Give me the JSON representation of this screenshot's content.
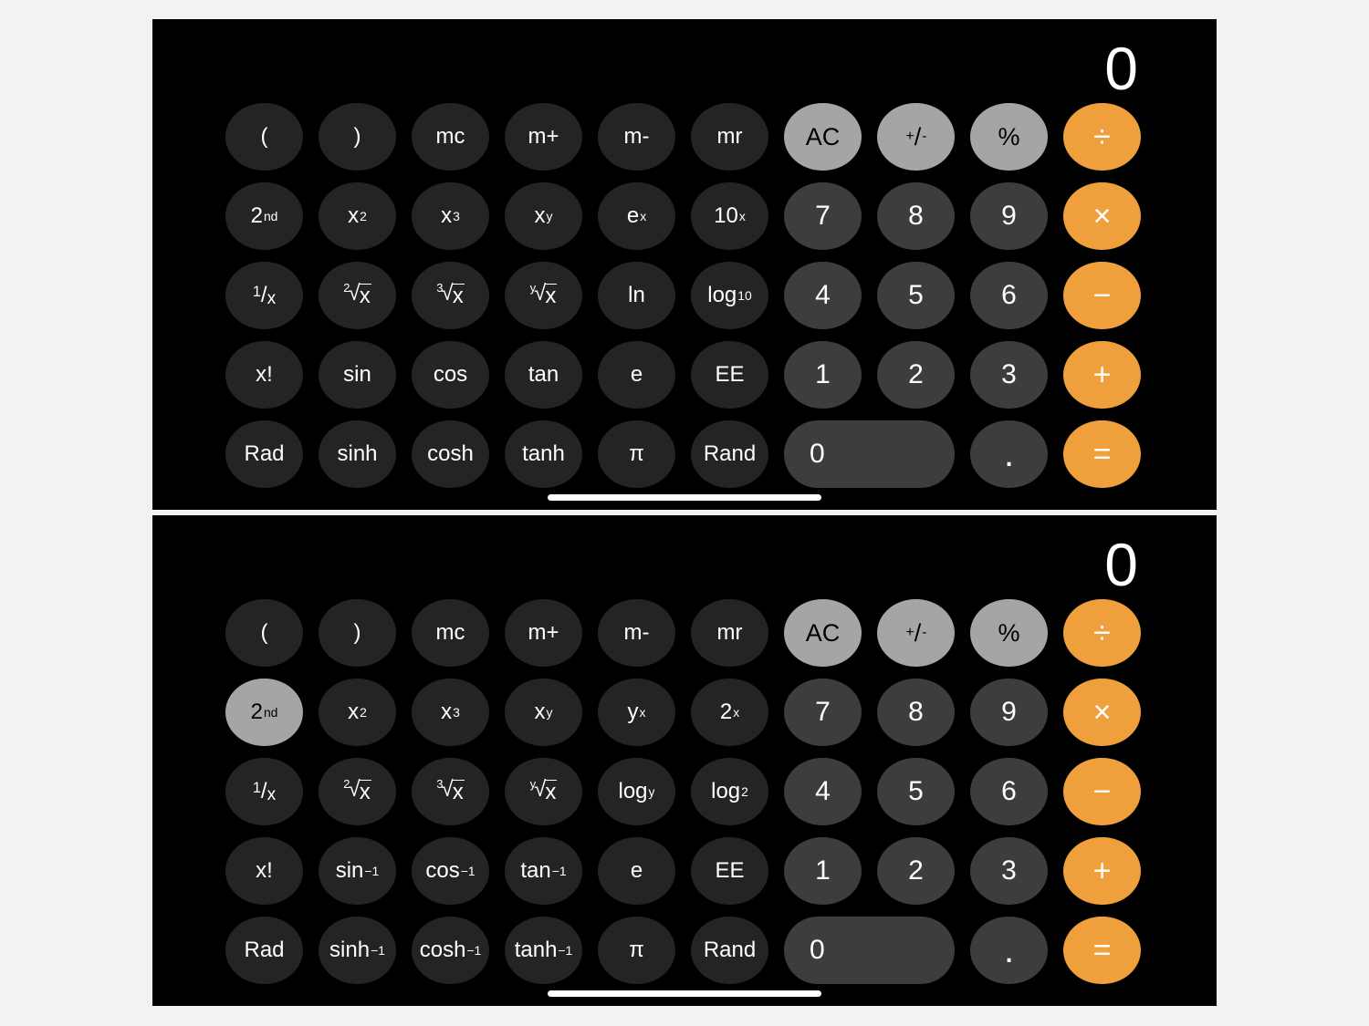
{
  "page": {
    "background_color": "#f2f2f2"
  },
  "colors": {
    "screen_background": "#000000",
    "function_key": "#242424",
    "number_key": "#3d3d3d",
    "utility_key": "#a5a5a5",
    "operator_key": "#ef9f3c",
    "active_key": "#a5a5a5",
    "text_light": "#ffffff",
    "text_dark": "#000000"
  },
  "calculators": [
    {
      "id": "scientific-primary",
      "display_value": "0",
      "second_function_active": false,
      "rows": [
        [
          {
            "label": "(",
            "name": "open-paren",
            "type": "fn"
          },
          {
            "label": ")",
            "name": "close-paren",
            "type": "fn"
          },
          {
            "label": "mc",
            "name": "memory-clear",
            "type": "fn"
          },
          {
            "label": "m+",
            "name": "memory-add",
            "type": "fn"
          },
          {
            "label": "m-",
            "name": "memory-subtract",
            "type": "fn"
          },
          {
            "label": "mr",
            "name": "memory-recall",
            "type": "fn"
          },
          {
            "label": "AC",
            "name": "all-clear",
            "type": "util"
          },
          {
            "label": "+/-",
            "name": "sign-toggle",
            "type": "util",
            "html": "<sup>+</sup>/<sub>-</sub>"
          },
          {
            "label": "%",
            "name": "percent",
            "type": "util"
          },
          {
            "label": "÷",
            "name": "divide",
            "type": "op"
          }
        ],
        [
          {
            "label": "2nd",
            "name": "second-function",
            "type": "fn",
            "html": "2<sup>nd</sup>"
          },
          {
            "label": "x²",
            "name": "x-squared",
            "type": "fn",
            "html": "x<sup>2</sup>"
          },
          {
            "label": "x³",
            "name": "x-cubed",
            "type": "fn",
            "html": "x<sup>3</sup>"
          },
          {
            "label": "xʸ",
            "name": "x-to-the-y",
            "type": "fn",
            "html": "x<sup>y</sup>"
          },
          {
            "label": "eˣ",
            "name": "e-to-the-x",
            "type": "fn",
            "html": "e<sup>x</sup>"
          },
          {
            "label": "10ˣ",
            "name": "ten-to-the-x",
            "type": "fn",
            "html": "10<sup>x</sup>"
          },
          {
            "label": "7",
            "name": "digit-7",
            "type": "num"
          },
          {
            "label": "8",
            "name": "digit-8",
            "type": "num"
          },
          {
            "label": "9",
            "name": "digit-9",
            "type": "num"
          },
          {
            "label": "×",
            "name": "multiply",
            "type": "op"
          }
        ],
        [
          {
            "label": "1/x",
            "name": "reciprocal",
            "type": "fn",
            "html": "<span class='frac'><span class='n'>1</span><span class='sl'>/</span><span class='d'>x</span></span>"
          },
          {
            "label": "²√x",
            "name": "square-root",
            "type": "fn",
            "html": "<span class='rad'><span class='idx'>2</span><span class='sq'>&#8730;</span><span class='rx'>x</span></span>"
          },
          {
            "label": "³√x",
            "name": "cube-root",
            "type": "fn",
            "html": "<span class='rad'><span class='idx'>3</span><span class='sq'>&#8730;</span><span class='rx'>x</span></span>"
          },
          {
            "label": "ʸ√x",
            "name": "y-root",
            "type": "fn",
            "html": "<span class='rad'><span class='idx'>y</span><span class='sq'>&#8730;</span><span class='rx'>x</span></span>"
          },
          {
            "label": "ln",
            "name": "natural-log",
            "type": "fn"
          },
          {
            "label": "log10",
            "name": "log-base-10",
            "type": "fn",
            "html": "log<sub>10</sub>"
          },
          {
            "label": "4",
            "name": "digit-4",
            "type": "num"
          },
          {
            "label": "5",
            "name": "digit-5",
            "type": "num"
          },
          {
            "label": "6",
            "name": "digit-6",
            "type": "num"
          },
          {
            "label": "−",
            "name": "subtract",
            "type": "op"
          }
        ],
        [
          {
            "label": "x!",
            "name": "factorial",
            "type": "fn"
          },
          {
            "label": "sin",
            "name": "sine",
            "type": "fn"
          },
          {
            "label": "cos",
            "name": "cosine",
            "type": "fn"
          },
          {
            "label": "tan",
            "name": "tangent",
            "type": "fn"
          },
          {
            "label": "e",
            "name": "euler-constant",
            "type": "fn"
          },
          {
            "label": "EE",
            "name": "exponent-entry",
            "type": "fn"
          },
          {
            "label": "1",
            "name": "digit-1",
            "type": "num"
          },
          {
            "label": "2",
            "name": "digit-2",
            "type": "num"
          },
          {
            "label": "3",
            "name": "digit-3",
            "type": "num"
          },
          {
            "label": "+",
            "name": "add",
            "type": "op"
          }
        ],
        [
          {
            "label": "Rad",
            "name": "radian-mode",
            "type": "fn"
          },
          {
            "label": "sinh",
            "name": "hyperbolic-sine",
            "type": "fn"
          },
          {
            "label": "cosh",
            "name": "hyperbolic-cosine",
            "type": "fn"
          },
          {
            "label": "tanh",
            "name": "hyperbolic-tangent",
            "type": "fn"
          },
          {
            "label": "π",
            "name": "pi-constant",
            "type": "fn"
          },
          {
            "label": "Rand",
            "name": "random-number",
            "type": "fn"
          },
          {
            "label": "0",
            "name": "digit-0",
            "type": "num",
            "wide": true
          },
          {
            "label": ".",
            "name": "decimal-point",
            "type": "num",
            "dot": true
          },
          {
            "label": "=",
            "name": "equals",
            "type": "op"
          }
        ]
      ]
    },
    {
      "id": "scientific-second",
      "display_value": "0",
      "second_function_active": true,
      "rows": [
        [
          {
            "label": "(",
            "name": "open-paren",
            "type": "fn"
          },
          {
            "label": ")",
            "name": "close-paren",
            "type": "fn"
          },
          {
            "label": "mc",
            "name": "memory-clear",
            "type": "fn"
          },
          {
            "label": "m+",
            "name": "memory-add",
            "type": "fn"
          },
          {
            "label": "m-",
            "name": "memory-subtract",
            "type": "fn"
          },
          {
            "label": "mr",
            "name": "memory-recall",
            "type": "fn"
          },
          {
            "label": "AC",
            "name": "all-clear",
            "type": "util"
          },
          {
            "label": "+/-",
            "name": "sign-toggle",
            "type": "util",
            "html": "<sup>+</sup>/<sub>-</sub>"
          },
          {
            "label": "%",
            "name": "percent",
            "type": "util"
          },
          {
            "label": "÷",
            "name": "divide",
            "type": "op"
          }
        ],
        [
          {
            "label": "2nd",
            "name": "second-function",
            "type": "fn",
            "html": "2<sup>nd</sup>",
            "active": true
          },
          {
            "label": "x²",
            "name": "x-squared",
            "type": "fn",
            "html": "x<sup>2</sup>"
          },
          {
            "label": "x³",
            "name": "x-cubed",
            "type": "fn",
            "html": "x<sup>3</sup>"
          },
          {
            "label": "xʸ",
            "name": "x-to-the-y",
            "type": "fn",
            "html": "x<sup>y</sup>"
          },
          {
            "label": "yˣ",
            "name": "y-to-the-x",
            "type": "fn",
            "html": "y<sup>x</sup>"
          },
          {
            "label": "2ˣ",
            "name": "two-to-the-x",
            "type": "fn",
            "html": "2<sup>x</sup>"
          },
          {
            "label": "7",
            "name": "digit-7",
            "type": "num"
          },
          {
            "label": "8",
            "name": "digit-8",
            "type": "num"
          },
          {
            "label": "9",
            "name": "digit-9",
            "type": "num"
          },
          {
            "label": "×",
            "name": "multiply",
            "type": "op"
          }
        ],
        [
          {
            "label": "1/x",
            "name": "reciprocal",
            "type": "fn",
            "html": "<span class='frac'><span class='n'>1</span><span class='sl'>/</span><span class='d'>x</span></span>"
          },
          {
            "label": "²√x",
            "name": "square-root",
            "type": "fn",
            "html": "<span class='rad'><span class='idx'>2</span><span class='sq'>&#8730;</span><span class='rx'>x</span></span>"
          },
          {
            "label": "³√x",
            "name": "cube-root",
            "type": "fn",
            "html": "<span class='rad'><span class='idx'>3</span><span class='sq'>&#8730;</span><span class='rx'>x</span></span>"
          },
          {
            "label": "ʸ√x",
            "name": "y-root",
            "type": "fn",
            "html": "<span class='rad'><span class='idx'>y</span><span class='sq'>&#8730;</span><span class='rx'>x</span></span>"
          },
          {
            "label": "logy",
            "name": "log-base-y",
            "type": "fn",
            "html": "log<sub>y</sub>"
          },
          {
            "label": "log2",
            "name": "log-base-2",
            "type": "fn",
            "html": "log<sub>2</sub>"
          },
          {
            "label": "4",
            "name": "digit-4",
            "type": "num"
          },
          {
            "label": "5",
            "name": "digit-5",
            "type": "num"
          },
          {
            "label": "6",
            "name": "digit-6",
            "type": "num"
          },
          {
            "label": "−",
            "name": "subtract",
            "type": "op"
          }
        ],
        [
          {
            "label": "x!",
            "name": "factorial",
            "type": "fn"
          },
          {
            "label": "sin⁻¹",
            "name": "arcsine",
            "type": "fn",
            "html": "sin<sup>&#8722;1</sup>"
          },
          {
            "label": "cos⁻¹",
            "name": "arccosine",
            "type": "fn",
            "html": "cos<sup>&#8722;1</sup>"
          },
          {
            "label": "tan⁻¹",
            "name": "arctangent",
            "type": "fn",
            "html": "tan<sup>&#8722;1</sup>"
          },
          {
            "label": "e",
            "name": "euler-constant",
            "type": "fn"
          },
          {
            "label": "EE",
            "name": "exponent-entry",
            "type": "fn"
          },
          {
            "label": "1",
            "name": "digit-1",
            "type": "num"
          },
          {
            "label": "2",
            "name": "digit-2",
            "type": "num"
          },
          {
            "label": "3",
            "name": "digit-3",
            "type": "num"
          },
          {
            "label": "+",
            "name": "add",
            "type": "op"
          }
        ],
        [
          {
            "label": "Rad",
            "name": "radian-mode",
            "type": "fn"
          },
          {
            "label": "sinh⁻¹",
            "name": "inverse-hyperbolic-sine",
            "type": "fn",
            "html": "sinh<sup>&#8722;1</sup>"
          },
          {
            "label": "cosh⁻¹",
            "name": "inverse-hyperbolic-cosine",
            "type": "fn",
            "html": "cosh<sup>&#8722;1</sup>"
          },
          {
            "label": "tanh⁻¹",
            "name": "inverse-hyperbolic-tangent",
            "type": "fn",
            "html": "tanh<sup>&#8722;1</sup>"
          },
          {
            "label": "π",
            "name": "pi-constant",
            "type": "fn"
          },
          {
            "label": "Rand",
            "name": "random-number",
            "type": "fn"
          },
          {
            "label": "0",
            "name": "digit-0",
            "type": "num",
            "wide": true
          },
          {
            "label": ".",
            "name": "decimal-point",
            "type": "num",
            "dot": true
          },
          {
            "label": "=",
            "name": "equals",
            "type": "op"
          }
        ]
      ]
    }
  ]
}
